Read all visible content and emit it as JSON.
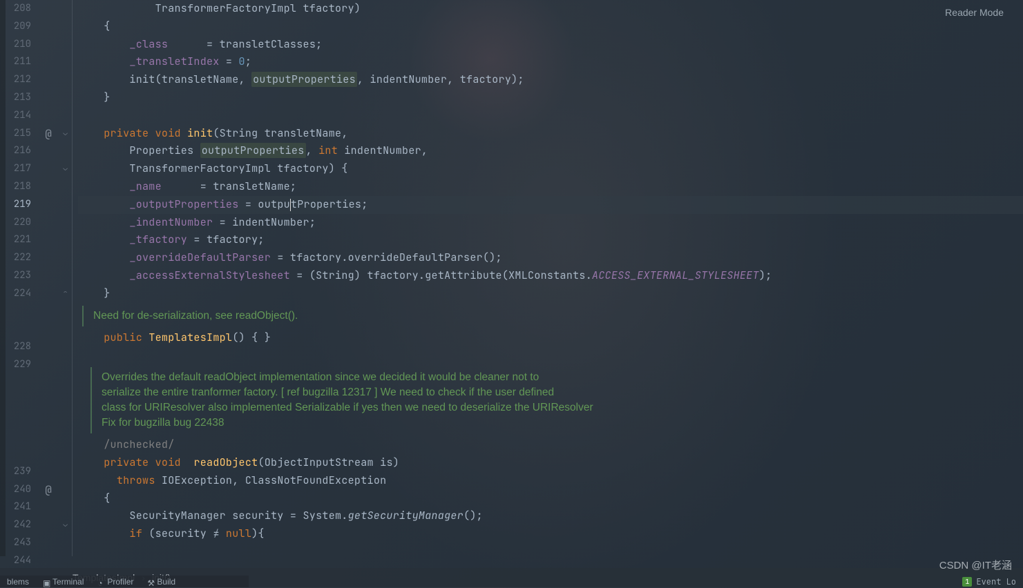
{
  "readerMode": "Reader Mode",
  "gutter": {
    "lines": [
      "208",
      "209",
      "210",
      "211",
      "212",
      "213",
      "214",
      "215",
      "216",
      "217",
      "218",
      "219",
      "220",
      "221",
      "222",
      "223",
      "224",
      "",
      "",
      "228",
      "229",
      "",
      "",
      "",
      "",
      "",
      "239",
      "240",
      "241",
      "242",
      "243",
      "244"
    ],
    "highlighted": "219"
  },
  "anno": {
    "215": "@",
    "240": "@"
  },
  "code": {
    "l208": "            TransformerFactoryImpl tfactory)",
    "l209": "    {",
    "l210_pre": "        ",
    "l210_f": "_class",
    "l210_mid": "      = transletClasses;",
    "l211_pre": "        ",
    "l211_f": "_transletIndex",
    "l211_mid": " = ",
    "l211_n": "0",
    "l211_end": ";",
    "l212_pre": "        init(transletName, ",
    "l212_p": "outputProperties",
    "l212_end": ", indentNumber, tfactory);",
    "l213": "    }",
    "l215_pre": "    ",
    "l215_k1": "private ",
    "l215_k2": "void ",
    "l215_m": "init",
    "l215_end": "(String transletName,",
    "l216_pre": "        Properties ",
    "l216_p": "outputProperties",
    "l216_mid": ", ",
    "l216_k": "int",
    "l216_end": " indentNumber,",
    "l217": "        TransformerFactoryImpl tfactory) {",
    "l218_pre": "        ",
    "l218_f": "_name",
    "l218_end": "      = transletName;",
    "l219_pre": "        ",
    "l219_f": "_outputProperties",
    "l219_mid": " = outpu",
    "l219_mid2": "tProperties;",
    "l220_pre": "        ",
    "l220_f": "_indentNumber",
    "l220_end": " = indentNumber;",
    "l221_pre": "        ",
    "l221_f": "_tfactory",
    "l221_end": " = tfactory;",
    "l222_pre": "        ",
    "l222_f": "_overrideDefaultParser",
    "l222_end": " = tfactory.overrideDefaultParser();",
    "l223_pre": "        ",
    "l223_f": "_accessExternalStylesheet",
    "l223_mid": " = (String) tfactory.getAttribute(XMLConstants.",
    "l223_sf": "ACCESS_EXTERNAL_STYLESHEET",
    "l223_end": ");",
    "l224": "    }",
    "doc1": "Need for de-serialization, see readObject().",
    "l228_pre": "    ",
    "l228_k": "public ",
    "l228_c": "TemplatesImpl",
    "l228_end": "() { }",
    "doc2a": "Overrides the default readObject implementation since we decided it would be cleaner not to",
    "doc2b": "serialize the entire tranformer factory. [ ref bugzilla 12317 ] We need to check if the user defined",
    "doc2c": "class for URIResolver also implemented Serializable if yes then we need to deserialize the URIResolver",
    "doc2d": "Fix for bugzilla bug 22438",
    "l239": "    /unchecked/",
    "l240_pre": "    ",
    "l240_k1": "private ",
    "l240_k2": "void  ",
    "l240_m": "readObject",
    "l240_end": "(ObjectInputStream is)",
    "l241_pre": "      ",
    "l241_k": "throws ",
    "l241_end": "IOException, ClassNotFoundException",
    "l242": "    {",
    "l243_pre": "        SecurityManager security = System.",
    "l243_m": "getSecurityManager",
    "l243_end": "();",
    "l244_pre": "        ",
    "l244_k": "if ",
    "l244_mid": "(security ≠ ",
    "l244_n": "null",
    "l244_end": "){"
  },
  "breadcrumb": {
    "a": "TemplatesImpl",
    "b": "init()"
  },
  "toolwin": {
    "a": "blems",
    "b": "Terminal",
    "c": "Profiler",
    "d": "Build"
  },
  "watermark": "CSDN @IT老涵",
  "status": {
    "num": "1",
    "label": "Event Lo"
  }
}
